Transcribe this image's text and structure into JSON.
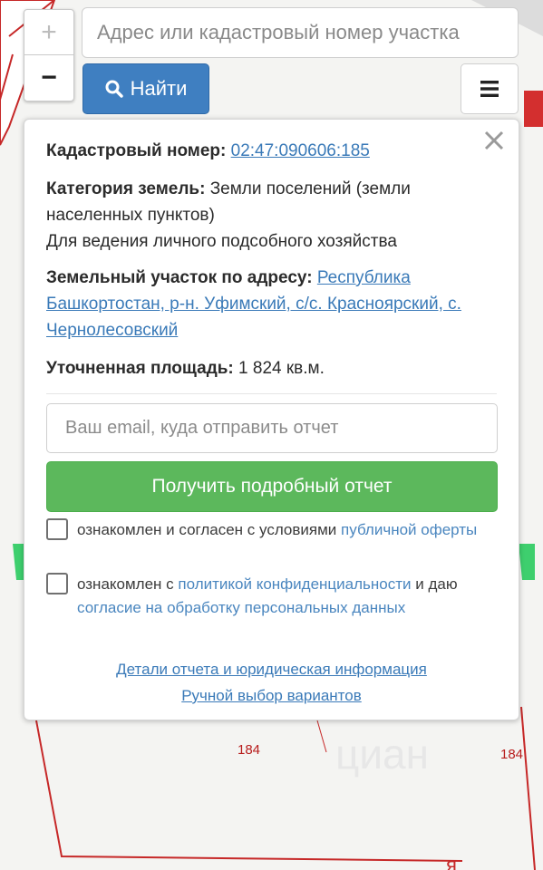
{
  "map": {
    "parcel_labels": [
      "184",
      "184"
    ],
    "watermark": "циан"
  },
  "controls": {
    "zoom_in": "+",
    "zoom_out": "−",
    "search_placeholder": "Адрес или кадастровый номер участка",
    "find_label": "Найти",
    "menu_icon": "hamburger-icon"
  },
  "info": {
    "cadastral_label": "Кадастровый номер:",
    "cadastral_number": "02:47:090606:185",
    "category_label": "Категория земель:",
    "category_value": "Земли поселений (земли населенных пунктов)",
    "usage": "Для ведения личного подсобного хозяйства",
    "address_label": "Земельный участок по адресу:",
    "address_value": "Республика Башкортостан, р-н. Уфимский, с/с. Красноярский, с. Чернолесовский",
    "area_label": "Уточненная площадь:",
    "area_value": "1 824 кв.м."
  },
  "form": {
    "email_placeholder": "Ваш email, куда отправить отчет",
    "submit_label": "Получить подробный отчет",
    "agree1_text": "ознакомлен и согласен с условиями",
    "agree1_link": "публичной оферты",
    "agree2_prefix": "ознакомлен с",
    "agree2_link1": "политикой конфиденциальности",
    "agree2_middle": "и даю",
    "agree2_link2": "согласие на обработку персональных данных"
  },
  "footer": {
    "details_link": "Детали отчета и юридическая информация",
    "manual_link": "Ручной выбор вариантов"
  },
  "colors": {
    "parcel_border": "#c62828",
    "find_button": "#3f7fc1",
    "submit_button": "#5cb85c",
    "link": "#3a7ab8"
  }
}
